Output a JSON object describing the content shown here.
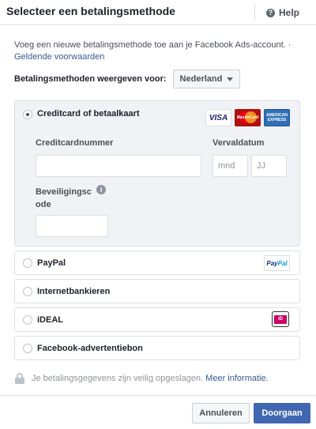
{
  "dialog": {
    "title": "Selecteer een betalingsmethode",
    "help_label": "Help"
  },
  "intro": {
    "text": "Voeg een nieuwe betalingsmethode toe aan je Facebook Ads-account. ·",
    "terms_link": "Geldende voorwaarden"
  },
  "country": {
    "label": "Betalingsmethoden weergeven voor:",
    "selected": "Nederland"
  },
  "card_option": {
    "label": "Creditcard of betaalkaart",
    "selected": true,
    "logos": {
      "visa": "VISA",
      "mastercard": "MasterCard",
      "amex": "AMERICAN EXPRESS"
    },
    "card_number_label": "Creditcardnummer",
    "card_number_value": "",
    "expiry_label": "Vervaldatum",
    "expiry_month_placeholder": "mnd",
    "expiry_year_placeholder": "JJ",
    "security_code_label_line1": "Beveiligingsc",
    "security_code_label_line2": "ode",
    "security_code_value": ""
  },
  "options": [
    {
      "label": "PayPal",
      "logo": "PayPal"
    },
    {
      "label": "Internetbankieren"
    },
    {
      "label": "iDEAL",
      "logo": "iD"
    },
    {
      "label": "Facebook-advertentiebon"
    }
  ],
  "secure": {
    "text": "Je betalingsgegevens zijn veilig opgeslagen.",
    "link": "Meer informatie."
  },
  "footer": {
    "cancel": "Annuleren",
    "next": "Doorgaan"
  },
  "colors": {
    "primary": "#4267b2",
    "link": "#365899",
    "selected_bg": "#f0f2f5",
    "ideal": "#cc0066"
  }
}
